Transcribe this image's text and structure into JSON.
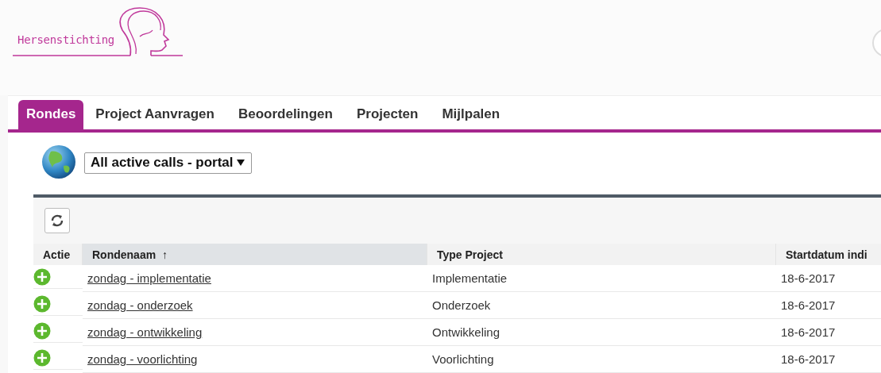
{
  "logo": {
    "text": "Hersenstichting"
  },
  "tabs": [
    {
      "label": "Rondes",
      "selected": true
    },
    {
      "label": "Project Aanvragen",
      "selected": false
    },
    {
      "label": "Beoordelingen",
      "selected": false
    },
    {
      "label": "Projecten",
      "selected": false
    },
    {
      "label": "Mijlpalen",
      "selected": false
    }
  ],
  "view_select": {
    "value": "All active calls - portal"
  },
  "table": {
    "columns": [
      {
        "label": "Actie",
        "sorted": false
      },
      {
        "label": "Rondenaam",
        "sorted": true,
        "sort_mark": "↑"
      },
      {
        "label": "Type Project",
        "sorted": false
      },
      {
        "label": "Startdatum indi",
        "sorted": false
      }
    ],
    "rows": [
      {
        "name": "zondag - implementatie",
        "type": "Implementatie",
        "start": "18-6-2017"
      },
      {
        "name": "zondag - onderzoek",
        "type": "Onderzoek",
        "start": "18-6-2017"
      },
      {
        "name": "zondag - ontwikkeling",
        "type": "Ontwikkeling",
        "start": "18-6-2017"
      },
      {
        "name": "zondag - voorlichting",
        "type": "Voorlichting",
        "start": "18-6-2017"
      }
    ]
  }
}
